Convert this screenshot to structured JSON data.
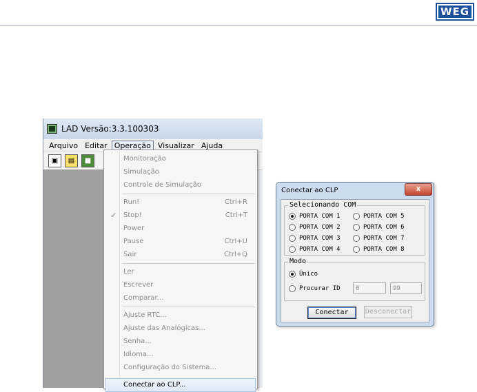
{
  "logo": {
    "text": "WEG"
  },
  "app_window": {
    "title": "LAD Versão:3.3.100303",
    "menu": [
      "Arquivo",
      "Editar",
      "Operação",
      "Visualizar",
      "Ajuda"
    ],
    "toolbar_icons": [
      "new-file-icon",
      "open-folder-icon",
      "save-icon"
    ]
  },
  "operacao_menu": {
    "items": [
      {
        "label": "Monitoração",
        "shortcut": ""
      },
      {
        "label": "Simulação",
        "shortcut": ""
      },
      {
        "label": "Controle de Simulação",
        "shortcut": ""
      },
      {
        "label": "Run!",
        "shortcut": "Ctrl+R"
      },
      {
        "label": "Stop!",
        "shortcut": "Ctrl+T",
        "checked": "✓"
      },
      {
        "label": "Power",
        "shortcut": ""
      },
      {
        "label": "Pause",
        "shortcut": "Ctrl+U"
      },
      {
        "label": "Sair",
        "shortcut": "Ctrl+Q"
      },
      {
        "label": "Ler",
        "shortcut": ""
      },
      {
        "label": "Escrever",
        "shortcut": ""
      },
      {
        "label": "Comparar...",
        "shortcut": ""
      },
      {
        "label": "Ajuste RTC...",
        "shortcut": ""
      },
      {
        "label": "Ajuste das Analógicas...",
        "shortcut": ""
      },
      {
        "label": "Senha...",
        "shortcut": ""
      },
      {
        "label": "Idioma...",
        "shortcut": ""
      },
      {
        "label": "Configuração do Sistema...",
        "shortcut": ""
      },
      {
        "label": "Conectar ao CLP...",
        "shortcut": ""
      }
    ]
  },
  "dialog": {
    "title": "Conectar ao CLP",
    "close_glyph": "x",
    "com_group": {
      "label": "Selecionando COM",
      "ports": [
        "PORTA COM 1",
        "PORTA COM 2",
        "PORTA COM 3",
        "PORTA COM 4",
        "PORTA COM 5",
        "PORTA COM 6",
        "PORTA COM 7",
        "PORTA COM 8"
      ],
      "selected": "PORTA COM 1"
    },
    "mode_group": {
      "label": "Modo",
      "unico": "Único",
      "procurar": "Procurar ID",
      "selected": "Único",
      "id_from": "0",
      "id_to": "99"
    },
    "buttons": {
      "connect": "Conectar",
      "disconnect": "Desconectar"
    }
  },
  "colors": {
    "dialog_frame": "#ccdcee",
    "close_red": "#c4452f",
    "logo_blue": "#1b4f9c"
  }
}
